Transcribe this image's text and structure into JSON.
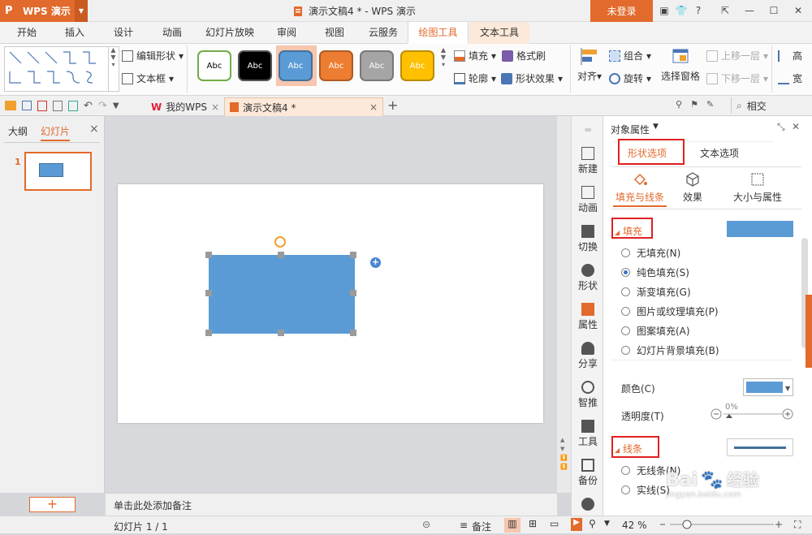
{
  "app": {
    "name": "WPS 演示",
    "logo": "P",
    "doc_title": "演示文稿4 * - WPS 演示",
    "login": "未登录",
    "help": "?"
  },
  "tabs": [
    "开始",
    "插入",
    "设计",
    "动画",
    "幻灯片放映",
    "审阅",
    "视图",
    "云服务",
    "绘图工具",
    "文本工具"
  ],
  "active_tab": "绘图工具",
  "toolbar": {
    "edit_shape": "编辑形状",
    "textbox": "文本框",
    "style_label": "Abc",
    "style_colors": [
      "#ffffff",
      "#000000",
      "#5b9bd5",
      "#ed7d31",
      "#a5a5a5",
      "#ffc000"
    ],
    "fill": "填充",
    "format_painter": "格式刷",
    "outline": "轮廓",
    "shape_effect": "形状效果",
    "align": "对齐",
    "group": "组合",
    "rotate": "旋转",
    "selection_pane": "选择窗格",
    "bring_forward": "上移一层",
    "send_backward": "下移一层",
    "more1": "高",
    "more2": "宽"
  },
  "quickbar": {
    "my_wps": "我的WPS",
    "doc_tab": "演示文稿4 *",
    "search": "相交"
  },
  "left_pane": {
    "tab_outline": "大纲",
    "tab_slides": "幻灯片",
    "slide_number": "1"
  },
  "notes": "单击此处添加备注",
  "side_items": [
    "新建",
    "动画",
    "切换",
    "形状",
    "属性",
    "分享",
    "智推",
    "工具",
    "备份"
  ],
  "props": {
    "title": "对象属性",
    "tab_shape": "形状选项",
    "tab_text": "文本选项",
    "sub_fill_line": "填充与线条",
    "sub_effect": "效果",
    "sub_size": "大小与属性",
    "fill_header": "填充",
    "fill_color": "#5b9bd5",
    "fill_options": [
      "无填充(N)",
      "纯色填充(S)",
      "渐变填充(G)",
      "图片或纹理填充(P)",
      "图案填充(A)",
      "幻灯片背景填充(B)"
    ],
    "selected_fill": "纯色填充(S)",
    "color_label": "颜色(C)",
    "transparency_label": "透明度(T)",
    "transparency_value": "0%",
    "transparency_level": 0,
    "line_header": "线条",
    "line_options": [
      "无线条(N)",
      "实线(S)"
    ]
  },
  "status": {
    "slide_info": "幻灯片 1 / 1",
    "notes_btn": "备注",
    "zoom": "42 %"
  },
  "shape": {
    "color": "#5b9bd5"
  },
  "watermark": {
    "text1": "Bai",
    "text2": "经验",
    "url": "jingyan.baidu.com"
  }
}
